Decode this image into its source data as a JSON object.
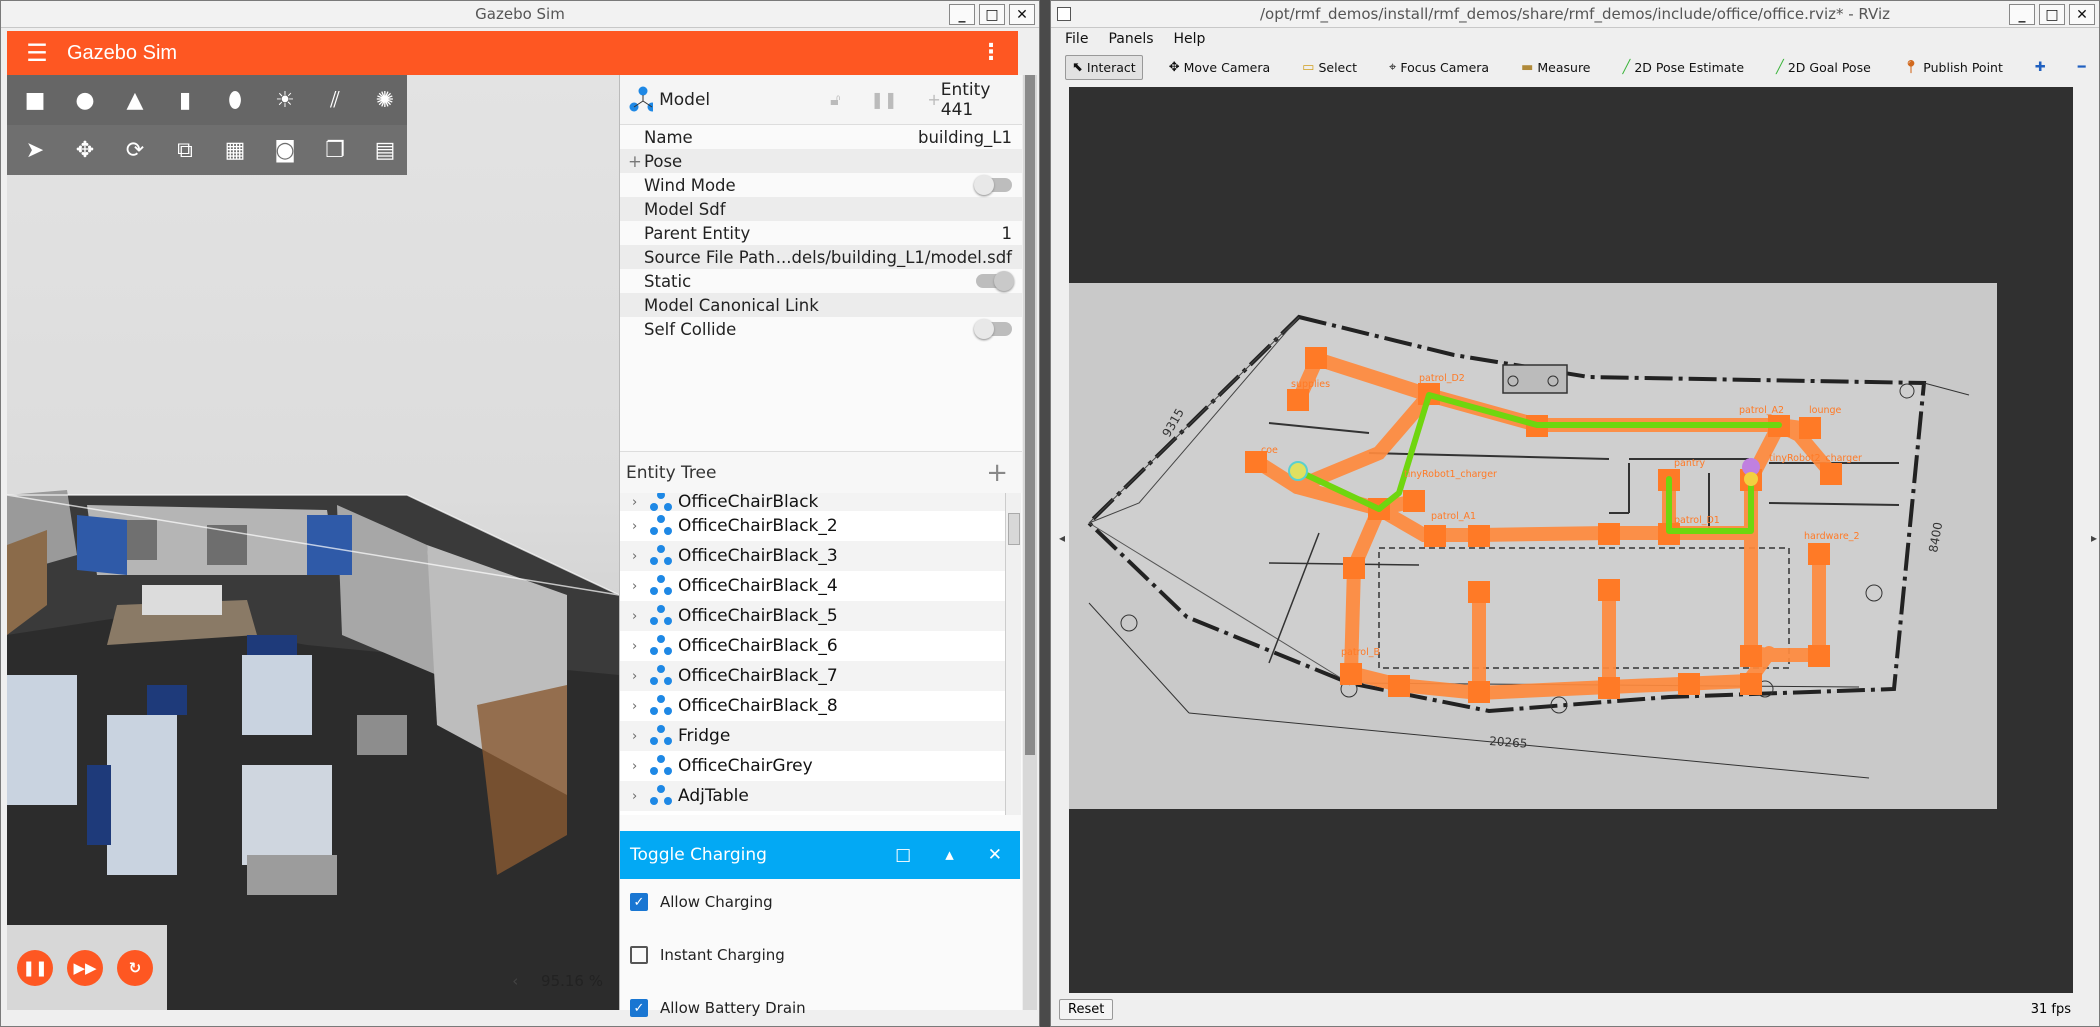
{
  "gazebo": {
    "window_title": "Gazebo Sim",
    "app_title": "Gazebo Sim",
    "rtf": "95.16 %",
    "rtf_chevron": "‹",
    "component_header": {
      "type": "Model",
      "entity": "Entity 441"
    },
    "properties": [
      {
        "label": "Name",
        "value": "building_L1"
      },
      {
        "label": "Pose",
        "value": ""
      },
      {
        "label": "Wind Mode",
        "value": ""
      },
      {
        "label": "Model Sdf",
        "value": ""
      },
      {
        "label": "Parent Entity",
        "value": "1"
      },
      {
        "label": "Source File Path",
        "value": "...dels/building_L1/model.sdf"
      },
      {
        "label": "Static",
        "value": ""
      },
      {
        "label": "Model Canonical Link",
        "value": ""
      },
      {
        "label": "Self Collide",
        "value": ""
      }
    ],
    "pose_expander": "+",
    "entity_tree_title": "Entity Tree",
    "entity_tree_add": "+",
    "entity_tree": [
      "OfficeChairBlack",
      "OfficeChairBlack_2",
      "OfficeChairBlack_3",
      "OfficeChairBlack_4",
      "OfficeChairBlack_5",
      "OfficeChairBlack_6",
      "OfficeChairBlack_7",
      "OfficeChairBlack_8",
      "Fridge",
      "OfficeChairGrey",
      "AdjTable"
    ],
    "toggle_charging": {
      "title": "Toggle Charging",
      "options": [
        {
          "label": "Allow Charging",
          "checked": true
        },
        {
          "label": "Instant Charging",
          "checked": false
        },
        {
          "label": "Allow Battery Drain",
          "checked": true
        }
      ]
    },
    "accent_color": "#fe5722",
    "plugin_header_color": "#03a9f4"
  },
  "rviz": {
    "window_title": "/opt/rmf_demos/install/rmf_demos/share/rmf_demos/include/office/office.rviz* - RViz",
    "menus": [
      "File",
      "Panels",
      "Help"
    ],
    "tools": [
      "Interact",
      "Move Camera",
      "Select",
      "Focus Camera",
      "Measure",
      "2D Pose Estimate",
      "2D Goal Pose",
      "Publish Point"
    ],
    "reset_label": "Reset",
    "fps": "31 fps",
    "map_labels": [
      "coe",
      "tinyRobot1_charger",
      "pantry",
      "lounge",
      "patrol_A2",
      "patrol_D1",
      "hardware_2",
      "patrol_B",
      "patrol_A1",
      "tinyRobot2_charger",
      "supplies",
      "patrol_D2"
    ],
    "dimension_labels": [
      "9315",
      "20265",
      "8400"
    ],
    "path_color": "#6fd60f",
    "lane_color": "#ff8a3d"
  }
}
